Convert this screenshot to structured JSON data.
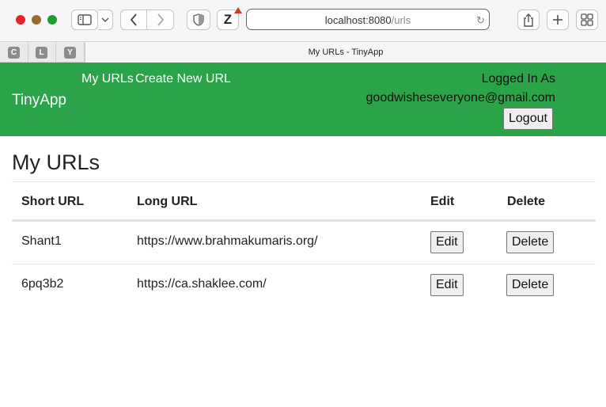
{
  "browser": {
    "url_host": "localhost:8080",
    "url_path": "/urls",
    "active_tab_title": "My URLs - TinyApp",
    "pinned_tabs": [
      "C",
      "L",
      "Y"
    ],
    "extension_label": "Z"
  },
  "navbar": {
    "brand": "TinyApp",
    "links": [
      "My URLs",
      "Create New URL"
    ],
    "logged_in_label": "Logged In As",
    "user_email": "goodwisheseveryone@gmail.com",
    "logout_label": "Logout",
    "bg_color": "#2ba348"
  },
  "page": {
    "title": "My URLs",
    "table": {
      "headers": [
        "Short URL",
        "Long URL",
        "Edit",
        "Delete"
      ],
      "rows": [
        {
          "short_url": "Shant1",
          "long_url": "https://www.brahmakumaris.org/",
          "edit_label": "Edit",
          "delete_label": "Delete"
        },
        {
          "short_url": "6pq3b2",
          "long_url": "https://ca.shaklee.com/",
          "edit_label": "Edit",
          "delete_label": "Delete"
        }
      ]
    }
  }
}
